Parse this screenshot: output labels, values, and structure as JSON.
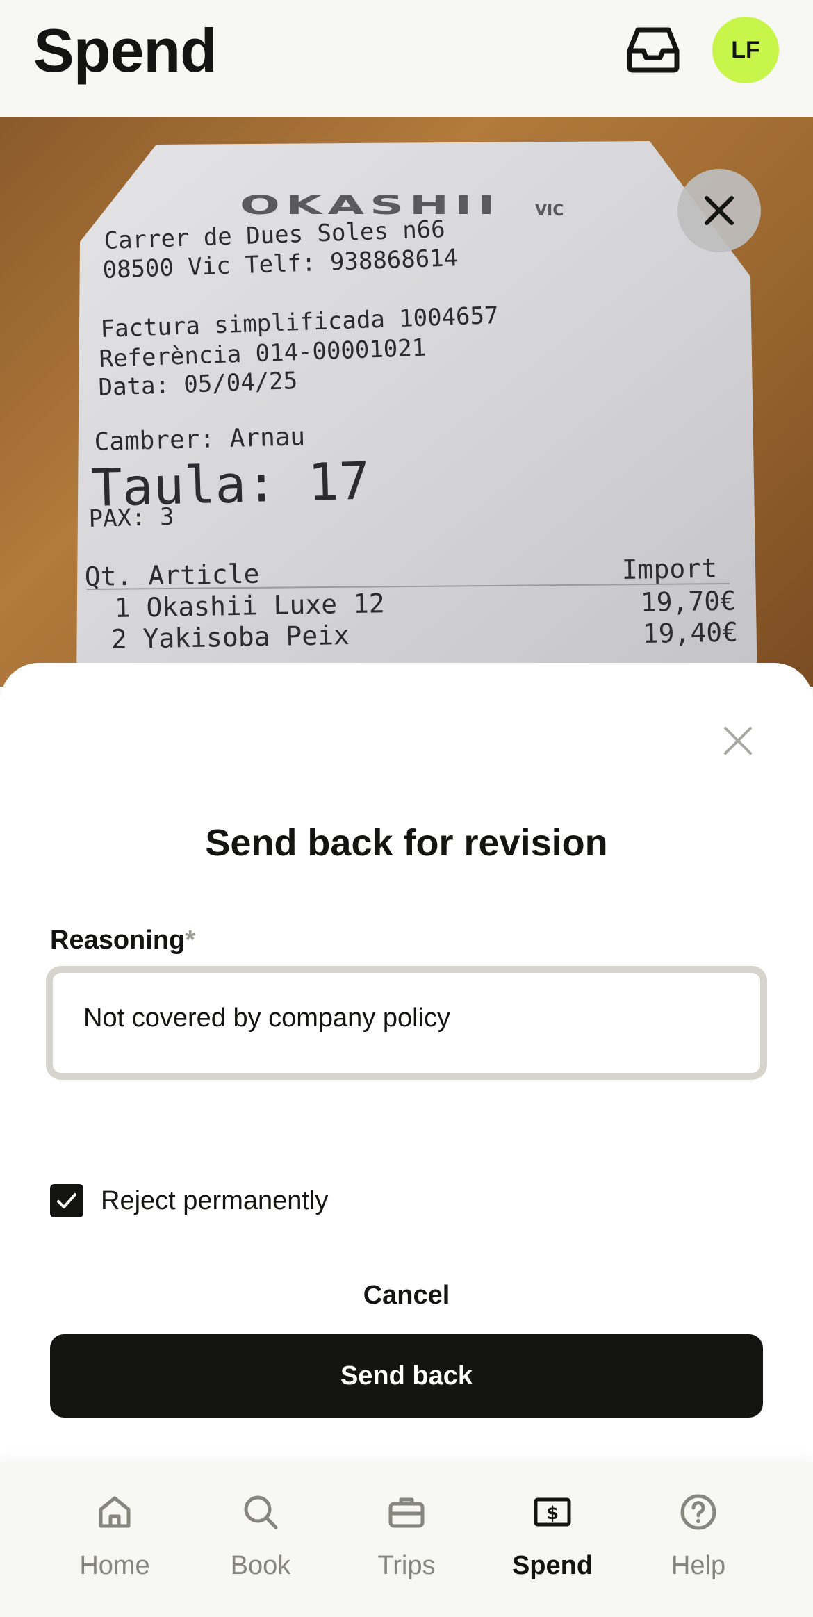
{
  "header": {
    "title": "Spend",
    "avatar_initials": "LF",
    "inbox_icon": "inbox-icon",
    "avatar_color": "#c8f54a"
  },
  "receipt": {
    "brand": "OKASHII",
    "brand_sub": "VIC",
    "lines": [
      "Carrer de Dues Soles n66",
      "08500  Vic    Telf: 938868614",
      "Factura simplificada 1004657",
      "Referència 014-00001021",
      "Data: 05/04/25",
      "Cambrer:  Arnau",
      "Taula:   17",
      "PAX:      3",
      "Qt. Article",
      "Import",
      "1 Okashii Luxe 12",
      "19,70€",
      "2 Yakisoba Peix",
      "19,40€"
    ],
    "close_icon": "close-icon"
  },
  "sheet": {
    "title": "Send back for revision",
    "reason_label": "Reasoning",
    "required_mark": "*",
    "reason_value": "Not covered by company policy",
    "checkbox_label": "Reject permanently",
    "checkbox_checked": true,
    "cancel_label": "Cancel",
    "submit_label": "Send back"
  },
  "nav": {
    "items": [
      {
        "label": "Home",
        "icon": "home-icon"
      },
      {
        "label": "Book",
        "icon": "search-icon"
      },
      {
        "label": "Trips",
        "icon": "briefcase-icon"
      },
      {
        "label": "Spend",
        "icon": "dollar-card-icon",
        "active": true
      },
      {
        "label": "Help",
        "icon": "help-icon"
      }
    ]
  }
}
